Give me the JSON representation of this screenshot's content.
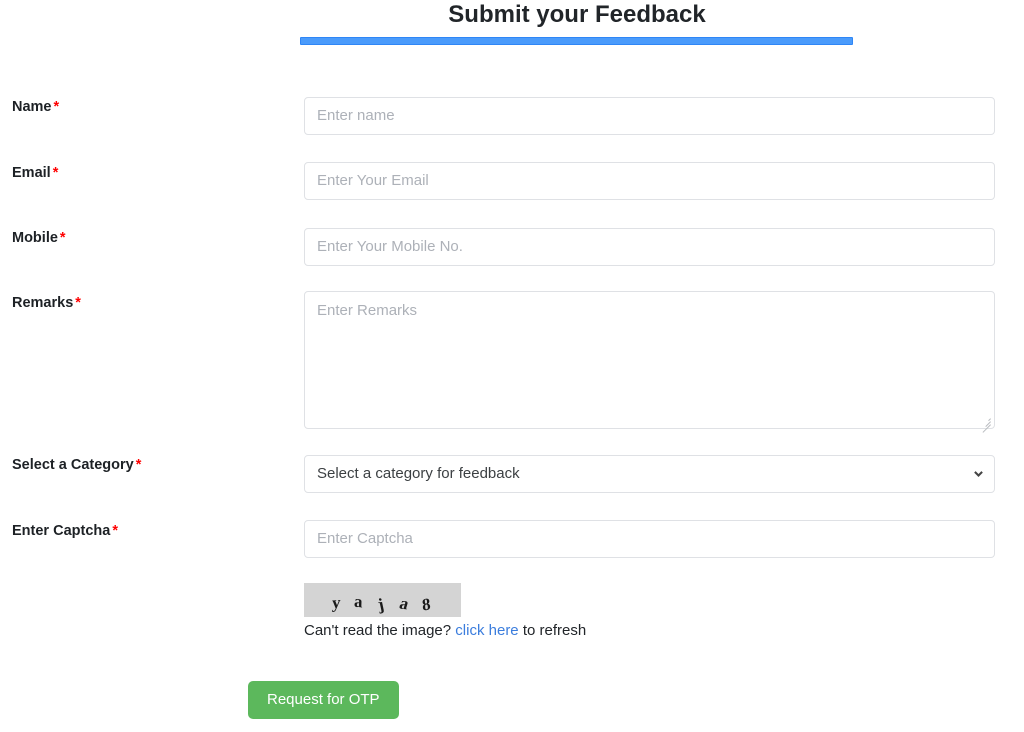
{
  "header": {
    "title": "Submit your Feedback"
  },
  "form": {
    "required_marker": "*",
    "fields": [
      {
        "label": "Name",
        "placeholder": "Enter name"
      },
      {
        "label": "Email",
        "placeholder": "Enter Your Email"
      },
      {
        "label": "Mobile",
        "placeholder": "Enter Your Mobile No."
      },
      {
        "label": "Remarks",
        "placeholder": "Enter Remarks"
      },
      {
        "label": "Select a Category",
        "placeholder": "Select a category for feedback"
      },
      {
        "label": "Enter Captcha",
        "placeholder": "Enter Captcha"
      }
    ]
  },
  "captcha": {
    "characters": [
      "y",
      "a",
      "j",
      "a",
      "8"
    ],
    "hint_prefix": "Can't read the image? ",
    "hint_link": "click here",
    "hint_suffix": " to refresh",
    "background_color": "#d4d4d4"
  },
  "actions": {
    "request_otp_label": "Request for OTP"
  },
  "colors": {
    "accent_blue": "#4a9bfb",
    "link_blue": "#3b7ddd",
    "required_red": "#ff0000",
    "button_green": "#5cb85c",
    "placeholder_gray": "#adb1b8"
  }
}
